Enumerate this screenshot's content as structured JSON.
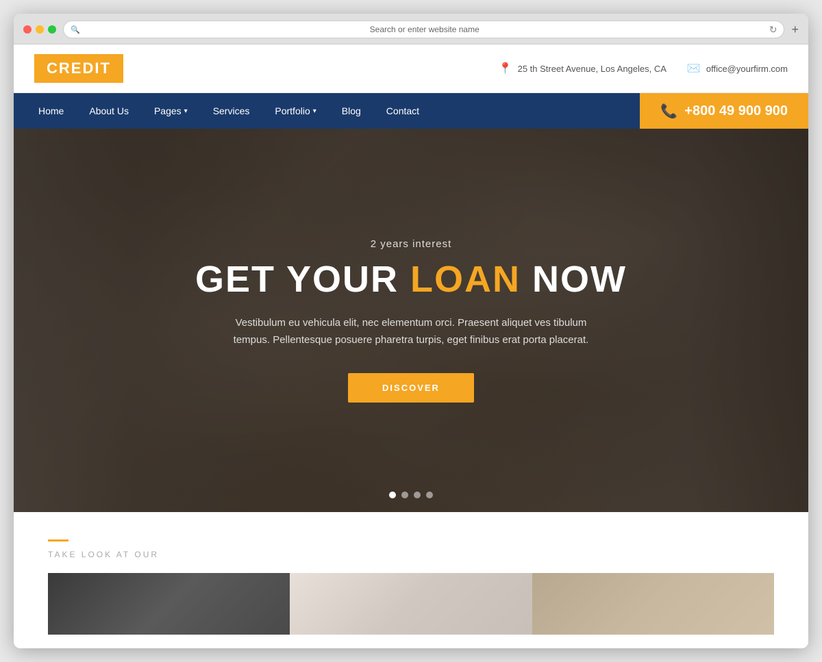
{
  "browser": {
    "address": "Search or enter website name"
  },
  "site": {
    "logo": "CREDIT",
    "topbar": {
      "address": "25 th Street Avenue, Los Angeles, CA",
      "email": "office@yourfirm.com"
    },
    "nav": {
      "phone": "+800 49 900 900",
      "items": [
        {
          "label": "Home",
          "has_dropdown": false
        },
        {
          "label": "About Us",
          "has_dropdown": false
        },
        {
          "label": "Pages",
          "has_dropdown": true
        },
        {
          "label": "Services",
          "has_dropdown": false
        },
        {
          "label": "Portfolio",
          "has_dropdown": true
        },
        {
          "label": "Blog",
          "has_dropdown": false
        },
        {
          "label": "Contact",
          "has_dropdown": false
        }
      ]
    },
    "hero": {
      "subtitle": "2 years interest",
      "title_part1": "GET YOUR ",
      "title_highlight": "LOAN",
      "title_part2": " NOW",
      "description": "Vestibulum eu vehicula elit, nec elementum orci. Praesent aliquet ves tibulum tempus. Pellentesque posuere pharetra turpis, eget finibus erat porta placerat.",
      "button": "DISCOVER",
      "dots": [
        "active",
        "",
        "",
        ""
      ]
    },
    "bottom": {
      "tag_label": "TAKE LOOK AT OUR"
    }
  }
}
